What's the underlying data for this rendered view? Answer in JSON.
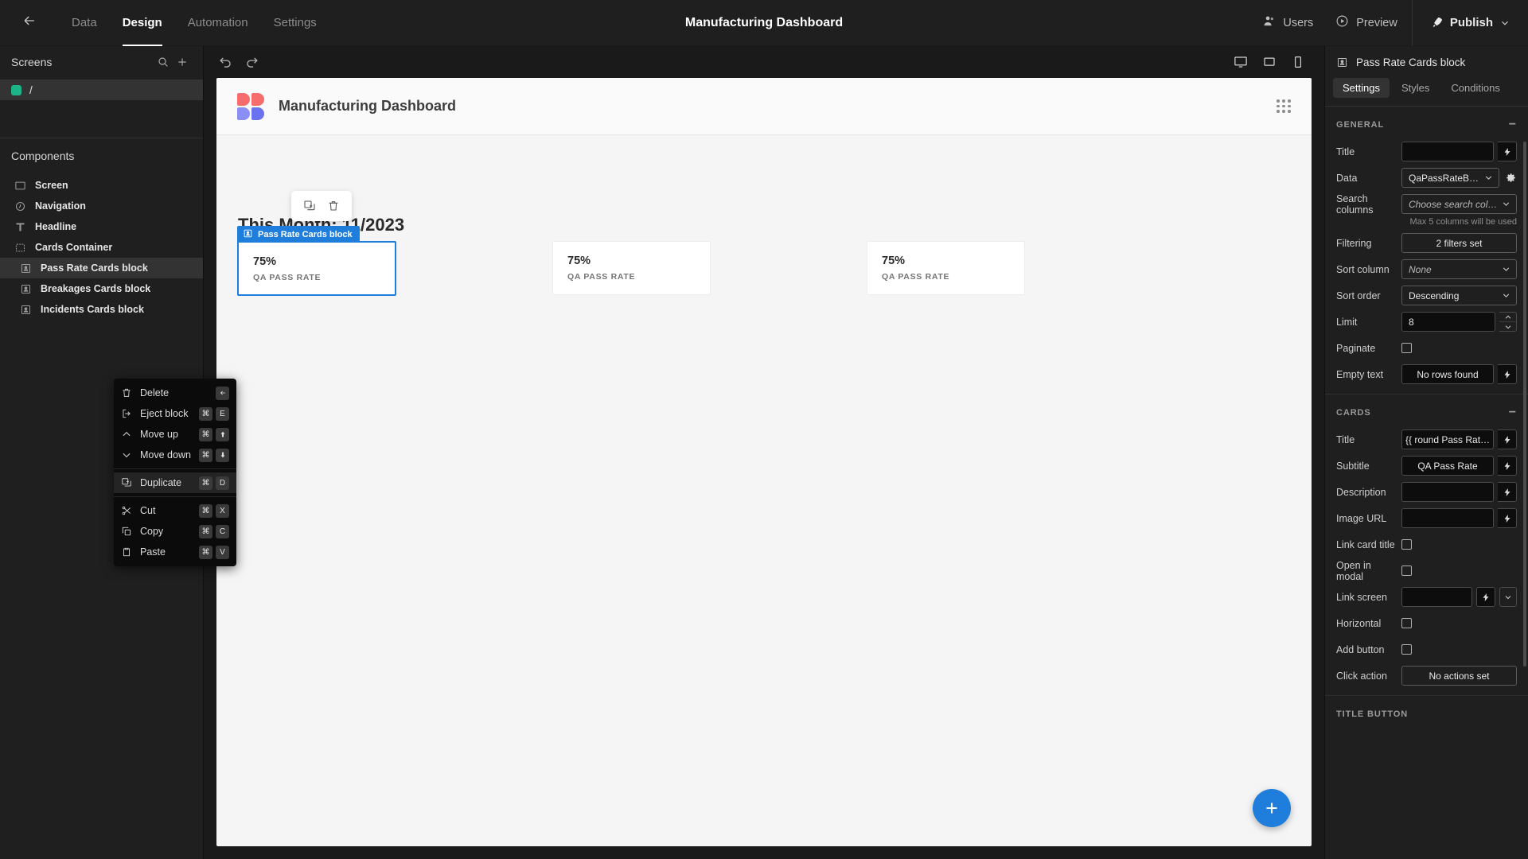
{
  "topbar": {
    "back_icon": "arrow-left-icon",
    "tabs": [
      {
        "label": "Data",
        "active": false
      },
      {
        "label": "Design",
        "active": true
      },
      {
        "label": "Automation",
        "active": false
      },
      {
        "label": "Settings",
        "active": false
      }
    ],
    "title": "Manufacturing Dashboard",
    "users_label": "Users",
    "preview_label": "Preview",
    "publish_label": "Publish"
  },
  "left_panel": {
    "screens_title": "Screens",
    "search_icon": "search-icon",
    "add_icon": "plus-icon",
    "screens": [
      {
        "label": "/",
        "color": "#1cb487",
        "selected": true
      }
    ],
    "components_title": "Components",
    "components_add_icon": "plus-icon",
    "components": [
      {
        "label": "Screen",
        "icon": "screen-icon",
        "level": 1,
        "selected": false
      },
      {
        "label": "Navigation",
        "icon": "navigation-icon",
        "level": 1,
        "selected": false
      },
      {
        "label": "Headline",
        "icon": "headline-icon",
        "level": 1,
        "selected": false
      },
      {
        "label": "Cards Container",
        "icon": "container-icon",
        "level": 1,
        "selected": false
      },
      {
        "label": "Pass Rate Cards block",
        "icon": "block-icon",
        "level": 2,
        "selected": true
      },
      {
        "label": "Breakages Cards block",
        "icon": "block-icon",
        "level": 2,
        "selected": false
      },
      {
        "label": "Incidents Cards block",
        "icon": "block-icon",
        "level": 2,
        "selected": false
      }
    ]
  },
  "context_menu": {
    "items": [
      {
        "label": "Delete",
        "icon": "trash-icon",
        "keys": [
          "backspace"
        ],
        "hover": false,
        "sep_after": false
      },
      {
        "label": "Eject block",
        "icon": "eject-icon",
        "keys": [
          "cmd",
          "E"
        ],
        "hover": false,
        "sep_after": false
      },
      {
        "label": "Move up",
        "icon": "chevron-up-icon",
        "keys": [
          "cmd",
          "arrow-up"
        ],
        "hover": false,
        "sep_after": false
      },
      {
        "label": "Move down",
        "icon": "chevron-down-icon",
        "keys": [
          "cmd",
          "arrow-down"
        ],
        "hover": false,
        "sep_after": true
      },
      {
        "label": "Duplicate",
        "icon": "duplicate-icon",
        "keys": [
          "cmd",
          "D"
        ],
        "hover": true,
        "sep_after": true
      },
      {
        "label": "Cut",
        "icon": "scissors-icon",
        "keys": [
          "cmd",
          "X"
        ],
        "hover": false,
        "sep_after": false
      },
      {
        "label": "Copy",
        "icon": "copy-icon",
        "keys": [
          "cmd",
          "C"
        ],
        "hover": false,
        "sep_after": false
      },
      {
        "label": "Paste",
        "icon": "paste-icon",
        "keys": [
          "cmd",
          "V"
        ],
        "hover": false,
        "sep_after": false
      }
    ],
    "cmd_symbol": "⌘"
  },
  "canvas": {
    "undo_icon": "undo-icon",
    "redo_icon": "redo-icon",
    "devices": [
      {
        "name": "desktop-icon",
        "active": true
      },
      {
        "name": "tablet-icon",
        "active": false
      },
      {
        "name": "mobile-icon",
        "active": false
      }
    ],
    "site_title": "Manufacturing Dashboard",
    "grip_icon": "grip-icon",
    "float_toolbar": [
      {
        "icon": "duplicate-icon"
      },
      {
        "icon": "trash-icon"
      }
    ],
    "month_heading": "This Month: 11/2023",
    "block_tag": "Pass Rate Cards block",
    "cards": [
      {
        "value": "75%",
        "subtitle": "QA PASS RATE",
        "selected": true
      },
      {
        "value": "75%",
        "subtitle": "QA PASS RATE",
        "selected": false
      },
      {
        "value": "75%",
        "subtitle": "QA PASS RATE",
        "selected": false
      }
    ],
    "fab_icon": "plus-icon",
    "accent": "#1f7ddb"
  },
  "right_panel": {
    "header_title": "Pass Rate Cards block",
    "header_icon": "block-icon",
    "tabs": [
      {
        "label": "Settings",
        "active": true
      },
      {
        "label": "Styles",
        "active": false
      },
      {
        "label": "Conditions",
        "active": false
      }
    ],
    "general": {
      "section_title": "GENERAL",
      "collapse": "−",
      "title_label": "Title",
      "title_value": "",
      "data_label": "Data",
      "data_value": "QaPassRateBy…",
      "search_columns_label": "Search columns",
      "search_columns_placeholder": "Choose search col…",
      "search_hint": "Max 5 columns will be used",
      "filtering_label": "Filtering",
      "filtering_value": "2 filters set",
      "sort_column_label": "Sort column",
      "sort_column_value": "None",
      "sort_order_label": "Sort order",
      "sort_order_value": "Descending",
      "limit_label": "Limit",
      "limit_value": "8",
      "paginate_label": "Paginate",
      "paginate_checked": false,
      "empty_text_label": "Empty text",
      "empty_text_value": "No rows found"
    },
    "cards": {
      "section_title": "CARDS",
      "collapse": "−",
      "title_label": "Title",
      "title_value": "{{ round Pass Rat…",
      "subtitle_label": "Subtitle",
      "subtitle_value": "QA Pass Rate",
      "description_label": "Description",
      "description_value": "",
      "image_url_label": "Image URL",
      "image_url_value": "",
      "link_card_title_label": "Link card title",
      "link_card_title_checked": false,
      "open_in_modal_label": "Open in modal",
      "open_in_modal_checked": false,
      "link_screen_label": "Link screen",
      "link_screen_value": "",
      "horizontal_label": "Horizontal",
      "horizontal_checked": false,
      "add_button_label": "Add button",
      "add_button_checked": false,
      "click_action_label": "Click action",
      "click_action_value": "No actions set"
    },
    "title_button": {
      "section_title": "TITLE BUTTON"
    }
  }
}
